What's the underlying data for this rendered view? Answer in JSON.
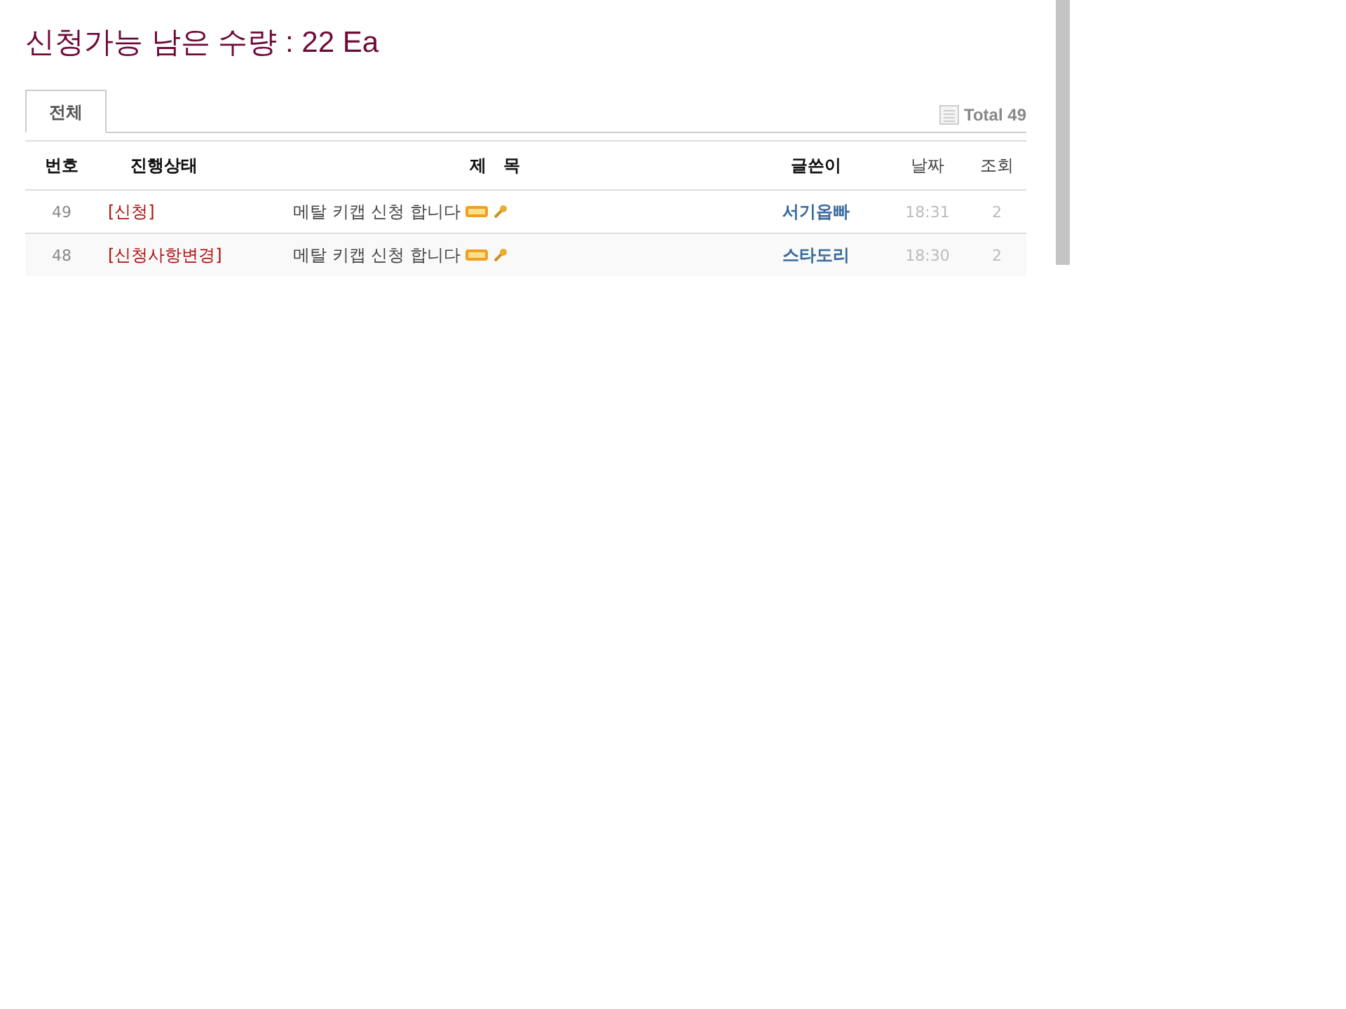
{
  "heading": "신청가능 남은 수량 : 22 Ea",
  "tabs": [
    {
      "label": "전체",
      "selected": true
    }
  ],
  "total": "Total 49",
  "table": {
    "columns": [
      "번호",
      "진행상태",
      "제　목",
      "글쓴이",
      "날짜",
      "조회"
    ],
    "rows": [
      {
        "number": "49",
        "status": "[신청]",
        "title": "메탈 키캡 신청 합니다",
        "new": true,
        "locked": true,
        "author": "서기옵빠",
        "date": "18:31",
        "views": "2"
      },
      {
        "number": "48",
        "status": "[신청사항변경]",
        "title": "메탈 키캡 신청 합니다",
        "new": true,
        "locked": true,
        "author": "스타도리",
        "date": "18:30",
        "views": "2"
      }
    ]
  }
}
